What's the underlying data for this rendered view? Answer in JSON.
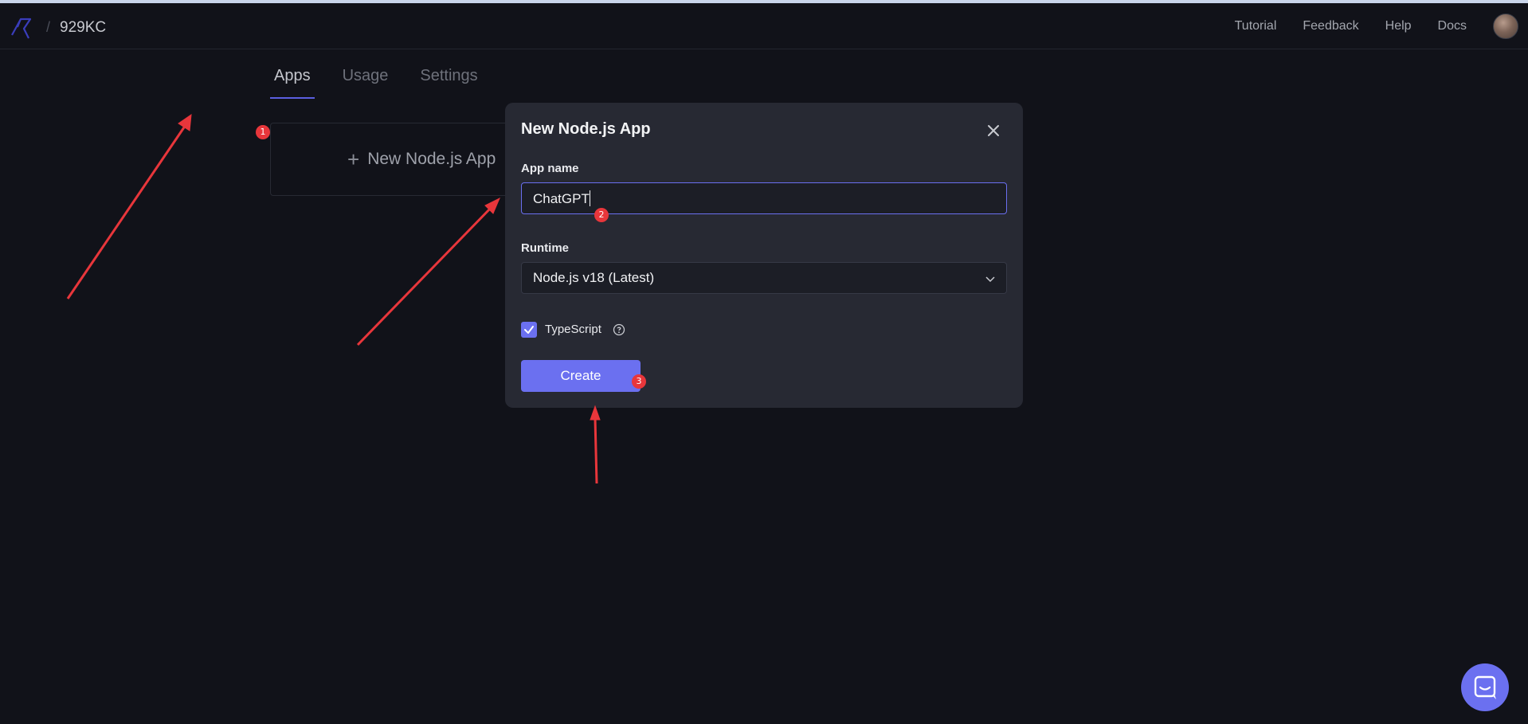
{
  "header": {
    "workspace": "929KC",
    "nav": [
      "Tutorial",
      "Feedback",
      "Help",
      "Docs"
    ]
  },
  "tabs": [
    "Apps",
    "Usage",
    "Settings"
  ],
  "card": {
    "label": "New Node.js App"
  },
  "modal": {
    "title": "New Node.js App",
    "app_name_label": "App name",
    "app_name_value": "ChatGPT",
    "runtime_label": "Runtime",
    "runtime_value": "Node.js v18 (Latest)",
    "typescript_label": "TypeScript",
    "typescript_checked": true,
    "create_label": "Create"
  },
  "badges": [
    "1",
    "2",
    "3"
  ],
  "colors": {
    "accent": "#6b70f0",
    "annotation": "#e8363b",
    "background": "#111219"
  }
}
